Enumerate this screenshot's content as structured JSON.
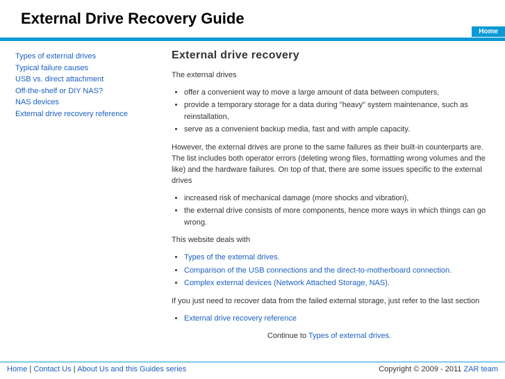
{
  "header": {
    "title": "External Drive Recovery Guide"
  },
  "nav": {
    "home": "Home"
  },
  "sidebar": {
    "items": [
      "Types of external drives",
      "Typical failure causes",
      "USB vs. direct attachment",
      "Off-the-shelf or DIY NAS?",
      "NAS devices",
      "External drive recovery reference"
    ]
  },
  "main": {
    "heading": "External drive recovery",
    "intro": "The external drives",
    "list1": [
      "offer a convenient way to move a large amount of data between computers,",
      "provide a temporary storage for a data during \"heavy\" system maintenance, such as reinstallation,",
      "serve as a convenient backup media, fast and with ample capacity."
    ],
    "para2": "However, the external drives are prone to the same failures as their built-in counterparts are. The list includes both operator errors (deleting wrong files, formatting wrong volumes and the like) and the hardware failures. On top of that, there are some issues specific to the external drives",
    "list2": [
      "increased risk of mechanical damage (more shocks and vibration),",
      "the external drive consists of more components, hence more ways in which things can go wrong."
    ],
    "para3": "This website deals with",
    "list3": [
      "Types of the external drives.",
      "Comparison of the USB connections and the direct-to-motherboard connection.",
      "Complex external devices (Network Attached Storage, NAS)."
    ],
    "para4": "If you just need to recover data from the failed external storage, just refer to the last section",
    "list4": [
      "External drive recovery reference"
    ],
    "continue_prefix": "Continue to ",
    "continue_link": "Types of external drives."
  },
  "footer": {
    "links": {
      "home": "Home",
      "contact": "Contact Us",
      "about": "About Us and this Guides series"
    },
    "sep": " | ",
    "copyright_prefix": "Copyright © 2009 - 2011 ",
    "copyright_link": "ZAR team"
  }
}
